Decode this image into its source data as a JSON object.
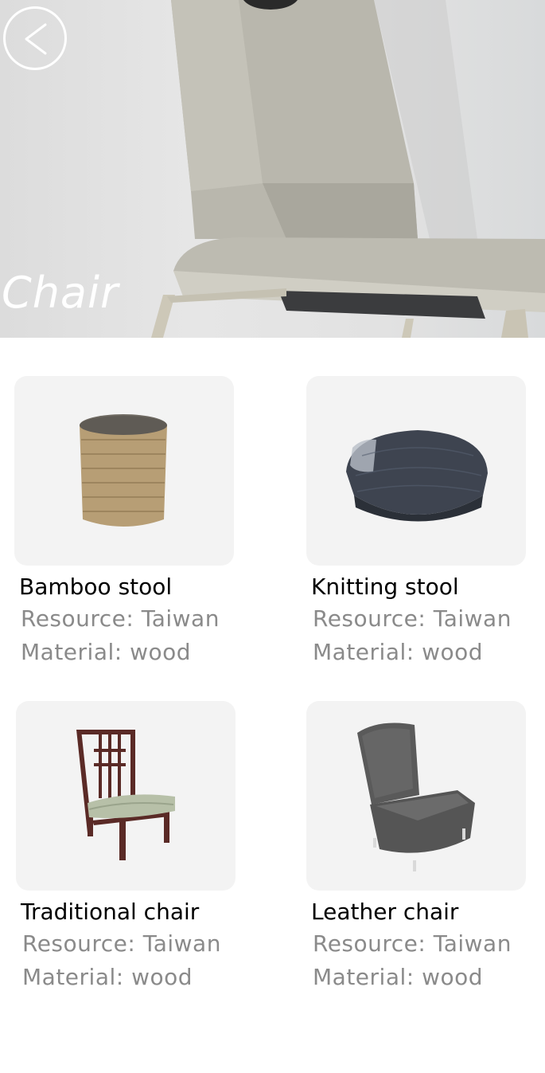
{
  "hero": {
    "title": "Chair",
    "back_icon": "chevron-left-icon"
  },
  "products": [
    {
      "name": "Bamboo stool",
      "resource": "Resource: Taiwan",
      "material": "Material: wood"
    },
    {
      "name": "Knitting stool",
      "resource": "Resource: Taiwan",
      "material": "Material: wood"
    },
    {
      "name": "Traditional chair",
      "resource": "Resource: Taiwan",
      "material": "Material: wood"
    },
    {
      "name": "Leather chair",
      "resource": "Resource: Taiwan",
      "material": "Material: wood"
    }
  ]
}
